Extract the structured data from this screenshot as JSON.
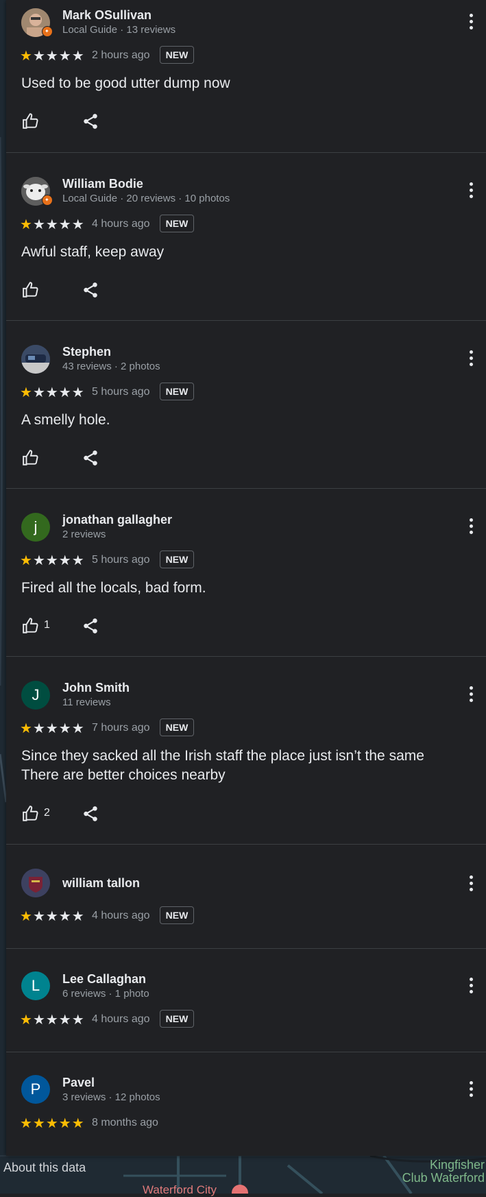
{
  "colors": {
    "star_on": "#fbbc04",
    "star_off": "#e8eaed",
    "local_guide_badge": "#e8711a"
  },
  "reviews": [
    {
      "name": "Mark OSullivan",
      "meta": "Local Guide · 13 reviews",
      "avatar": "photo",
      "local_guide": true,
      "rating": 1,
      "stars_text": "★★★★★",
      "time": "2 hours ago",
      "new_label": "NEW",
      "text": "Used to be good utter dump now",
      "likes": "",
      "more_icon": "more-vert-icon",
      "like_icon": "thumb-up-icon",
      "share_icon": "share-icon"
    },
    {
      "name": "William Bodie",
      "meta": "Local Guide · 20 reviews · 10 photos",
      "avatar": "photo",
      "local_guide": true,
      "rating": 1,
      "stars_text": "★★★★★",
      "time": "4 hours ago",
      "new_label": "NEW",
      "text": "Awful staff, keep away",
      "likes": ""
    },
    {
      "name": "Stephen",
      "meta": "43 reviews · 2 photos",
      "avatar": "photo",
      "rating": 1,
      "stars_text": "★★★★★",
      "time": "5 hours ago",
      "new_label": "NEW",
      "text": "A smelly hole.",
      "likes": ""
    },
    {
      "name": "jonathan gallagher",
      "meta": "2 reviews",
      "avatar_letter": "j",
      "avatar_color": "#33691e",
      "rating": 1,
      "stars_text": "★★★★★",
      "time": "5 hours ago",
      "new_label": "NEW",
      "text": "Fired all the locals, bad form.",
      "likes": "1"
    },
    {
      "name": "John Smith",
      "meta": "11 reviews",
      "avatar_letter": "J",
      "avatar_color": "#004d40",
      "rating": 1,
      "stars_text": "★★★★★",
      "time": "7 hours ago",
      "new_label": "NEW",
      "text_line1": "Since they sacked all the Irish staff the place just isn’t the same",
      "text_line2": "There are better choices nearby",
      "likes": "2"
    },
    {
      "name": "william tallon",
      "meta": "",
      "avatar": "photo",
      "rating": 1,
      "stars_text": "★★★★★",
      "time": "4 hours ago",
      "new_label": "NEW"
    },
    {
      "name": "Lee Callaghan",
      "meta": "6 reviews · 1 photo",
      "avatar_letter": "L",
      "avatar_color": "#00838f",
      "rating": 1,
      "stars_text": "★★★★★",
      "time": "4 hours ago",
      "new_label": "NEW"
    },
    {
      "name": "Pavel",
      "meta": "3 reviews · 12 photos",
      "avatar_letter": "P",
      "avatar_color": "#01579b",
      "rating": 5,
      "stars_text": "★★★★★",
      "time": "8 months ago"
    }
  ],
  "footer": {
    "about": "About this data",
    "place_line1": "Kingfisher",
    "place_line2": "Club Waterford",
    "city": "Waterford City"
  }
}
